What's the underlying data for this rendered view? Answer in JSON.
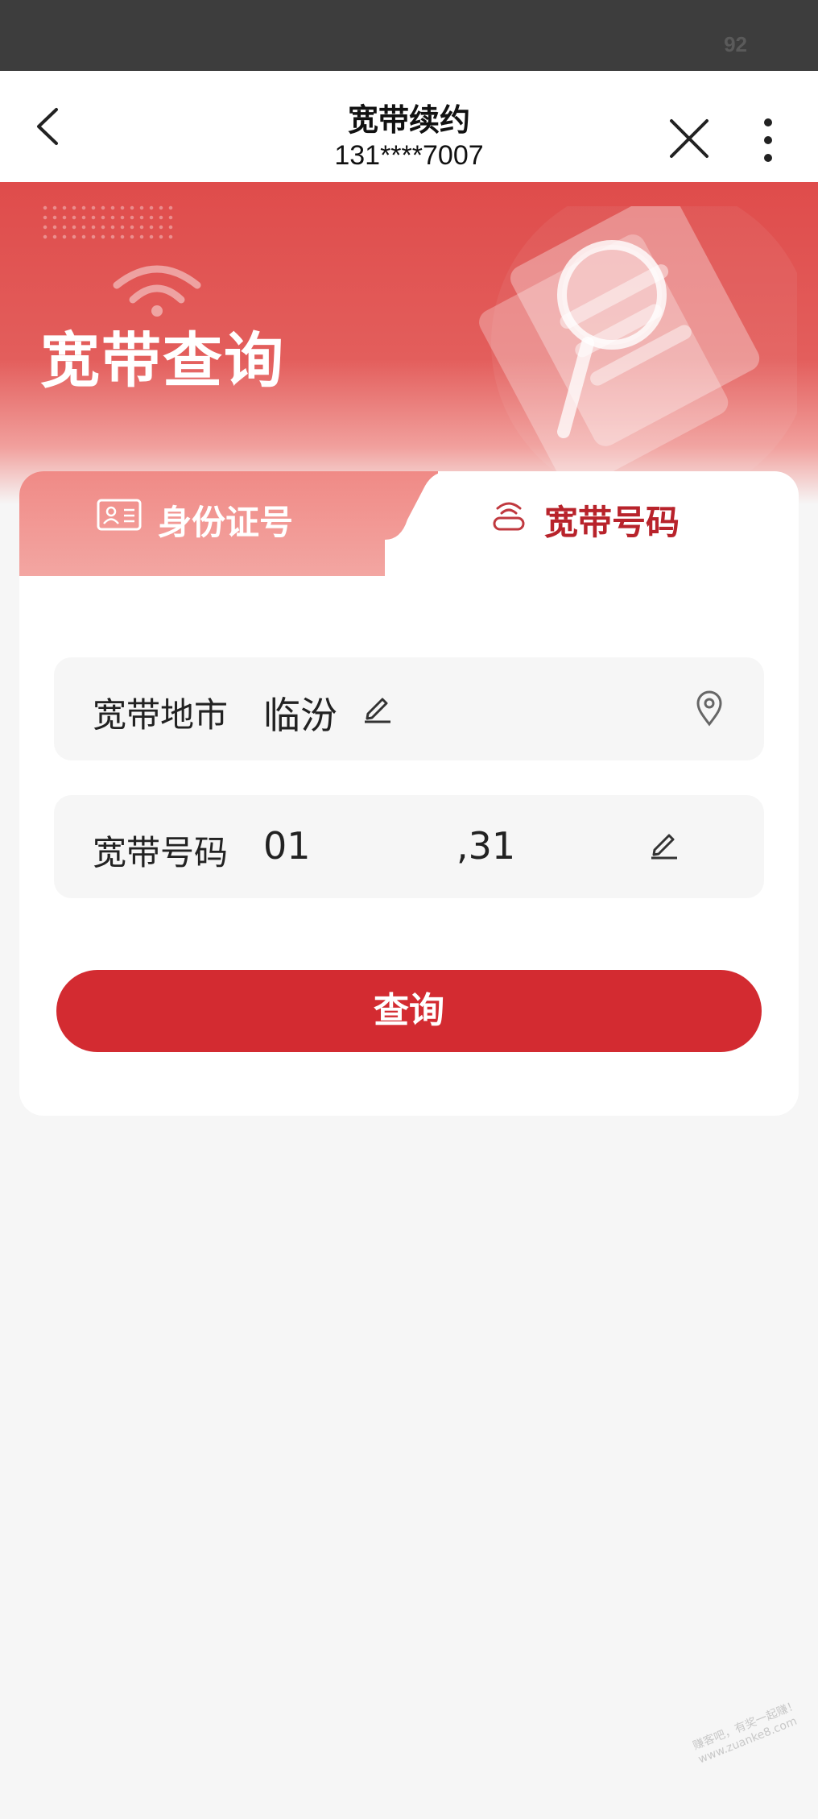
{
  "status_bar": {
    "indicator": "92"
  },
  "nav": {
    "title": "宽带续约",
    "subtitle": "131****7007",
    "icons": [
      "back-icon",
      "close-icon",
      "more-icon"
    ]
  },
  "banner": {
    "title": "宽带查询"
  },
  "tabs": [
    {
      "label": "身份证号",
      "icon": "id-card-icon",
      "selected": false
    },
    {
      "label": "宽带号码",
      "icon": "broadband-icon",
      "selected": true
    }
  ],
  "form": {
    "city": {
      "label": "宽带地市",
      "value": "临汾"
    },
    "number": {
      "label": "宽带号码",
      "value_start": "01",
      "value_end": ",31"
    }
  },
  "query_button": {
    "label": "查询"
  },
  "watermark": {
    "line1": "赚客吧，有奖一起赚！",
    "line2": "www.zuanke8.com"
  },
  "colors": {
    "accent": "#d32b31",
    "banner": "#e35e5c",
    "tab_active_text": "#b8232b"
  }
}
